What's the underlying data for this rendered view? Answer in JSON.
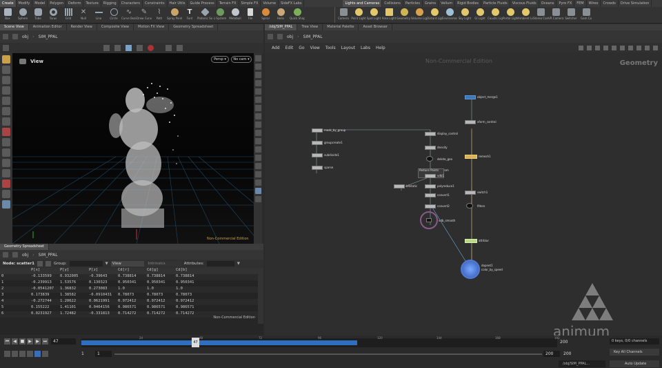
{
  "shelf": {
    "left_tabs": [
      "Create",
      "Modify",
      "Model",
      "Polygon",
      "Deform",
      "Texture",
      "Rigging",
      "Characters",
      "Constraints",
      "Hair Utils",
      "Guide Process",
      "Terrain FX",
      "Simple FX",
      "Volume",
      "SideFX Labs"
    ],
    "right_tabs": [
      "Lights and Cameras",
      "Collisions",
      "Particles",
      "Grains",
      "Vellum",
      "Rigid Bodies",
      "Particle Fluids",
      "Viscous Fluids",
      "Oceans",
      "Pyro FX",
      "FEM",
      "Wires",
      "Crowds",
      "Drive Simulation"
    ],
    "left_tools": [
      "Box",
      "Sphere",
      "Tube",
      "Torus",
      "Grid",
      "Null",
      "Line",
      "Circle",
      "Curve Bezier",
      "Draw Curve",
      "Path",
      "Spray Paint",
      "Font",
      "Platonic Solids",
      "L-System",
      "Metaball",
      "File",
      "Spiral",
      "Helix",
      "Quick Shapes"
    ],
    "right_tools": [
      "Camera",
      "Point Light",
      "Spot Light",
      "Area Light",
      "Geometry Light",
      "Volume Light",
      "Distant Light",
      "Environment Light",
      "Sky Light",
      "GI Light",
      "Caustic Light",
      "Portal Light",
      "Ambient Light",
      "Stereo Camera",
      "VR Camera",
      "Switcher",
      "Gam Ca"
    ]
  },
  "left_pane": {
    "tabs": [
      "Scene View",
      "Animation Editor",
      "Render View",
      "Composite View",
      "Motion FX View",
      "Geometry Spreadsheet"
    ],
    "path": "obj",
    "object": "SIM_PPAL",
    "viewport_label": "View",
    "persp_btn": "Persp ▾",
    "cam_btn": "No cam ▾",
    "watermark": "Non-Commercial Edition"
  },
  "right_pane": {
    "tabs": [
      "/obj/SIM_PPAL",
      "Tree View",
      "Material Palette",
      "Asset Browser"
    ],
    "path": "obj",
    "object": "SIM_PPAL",
    "menu": [
      "Add",
      "Edit",
      "Go",
      "View",
      "Tools",
      "Layout",
      "Labs",
      "Help"
    ],
    "watermark": "Non-Commercial Edition",
    "context": "Geometry"
  },
  "spreadsheet": {
    "title": "Geometry Spreadsheet",
    "path": "obj",
    "object": "SIM_PPAL",
    "node_label": "Node: scatter1",
    "group_label": "Group:",
    "view_label": "View",
    "intrinsics_label": "Intrinsics",
    "attributes_label": "Attributes:",
    "columns": [
      "",
      "P[x]",
      "P[y]",
      "P[z]",
      "Cd[r]",
      "Cd[g]",
      "Cd[b]"
    ],
    "rows": [
      [
        "0",
        "-0.133599",
        "0.932005",
        "-0.39643",
        "0.738814",
        "0.738814",
        "0.738814"
      ],
      [
        "1",
        "-0.239913",
        "1.53576",
        "0.130323",
        "0.950341",
        "0.950341",
        "0.950341"
      ],
      [
        "2",
        "-0.0541207",
        "1.36832",
        "0.273083",
        "1.0",
        "1.0",
        "1.0"
      ],
      [
        "3",
        "0.173839",
        "1.38582",
        "-0.0910431",
        "0.78073",
        "0.78073",
        "0.78073"
      ],
      [
        "4",
        "-0.272744",
        "1.20622",
        "0.0621991",
        "0.972412",
        "0.972412",
        "0.972412"
      ],
      [
        "5",
        "0.155222",
        "1.41101",
        "0.0464156",
        "0.986571",
        "0.986571",
        "0.986571"
      ],
      [
        "6",
        "0.0231927",
        "1.72482",
        "-0.331813",
        "0.714272",
        "0.714272",
        "0.714272"
      ]
    ],
    "watermark": "Non-Commercial Edition"
  },
  "nodes": [
    {
      "label": "object_merge1"
    },
    {
      "label": "xform_control"
    },
    {
      "label": "mask_by_group"
    },
    {
      "label": "groupcreate1"
    },
    {
      "label": "subdivide1"
    },
    {
      "label": "sparse"
    },
    {
      "label": "display_control"
    },
    {
      "label": "density"
    },
    {
      "label": "delete_geo"
    },
    {
      "label": "vdbfrom"
    },
    {
      "label": "Reduce Points"
    },
    {
      "label": "vdb1"
    },
    {
      "label": "bitstatic"
    },
    {
      "label": "polyreduce1"
    },
    {
      "label": "convert1"
    },
    {
      "label": "convert2"
    },
    {
      "label": "remesh1"
    },
    {
      "label": "vdb_smooth"
    },
    {
      "label": "switch1"
    },
    {
      "label": "filters"
    },
    {
      "label": "attrblur"
    },
    {
      "label": "dopnet1"
    },
    {
      "label": "color_by_speed"
    }
  ],
  "timeline": {
    "current_frame": "47",
    "start_frame": "1",
    "start_frame2": "1",
    "end_frame": "200",
    "end_frame2": "200",
    "ticks": [
      "24",
      "48",
      "72",
      "96",
      "120",
      "144",
      "168",
      "192"
    ],
    "keys_label": "0 keys, 0/0 channels",
    "key_all": "Key All Channels",
    "path": "/obj/SIM_PPAL...",
    "auto_update": "Auto Update"
  },
  "logo": "animum"
}
